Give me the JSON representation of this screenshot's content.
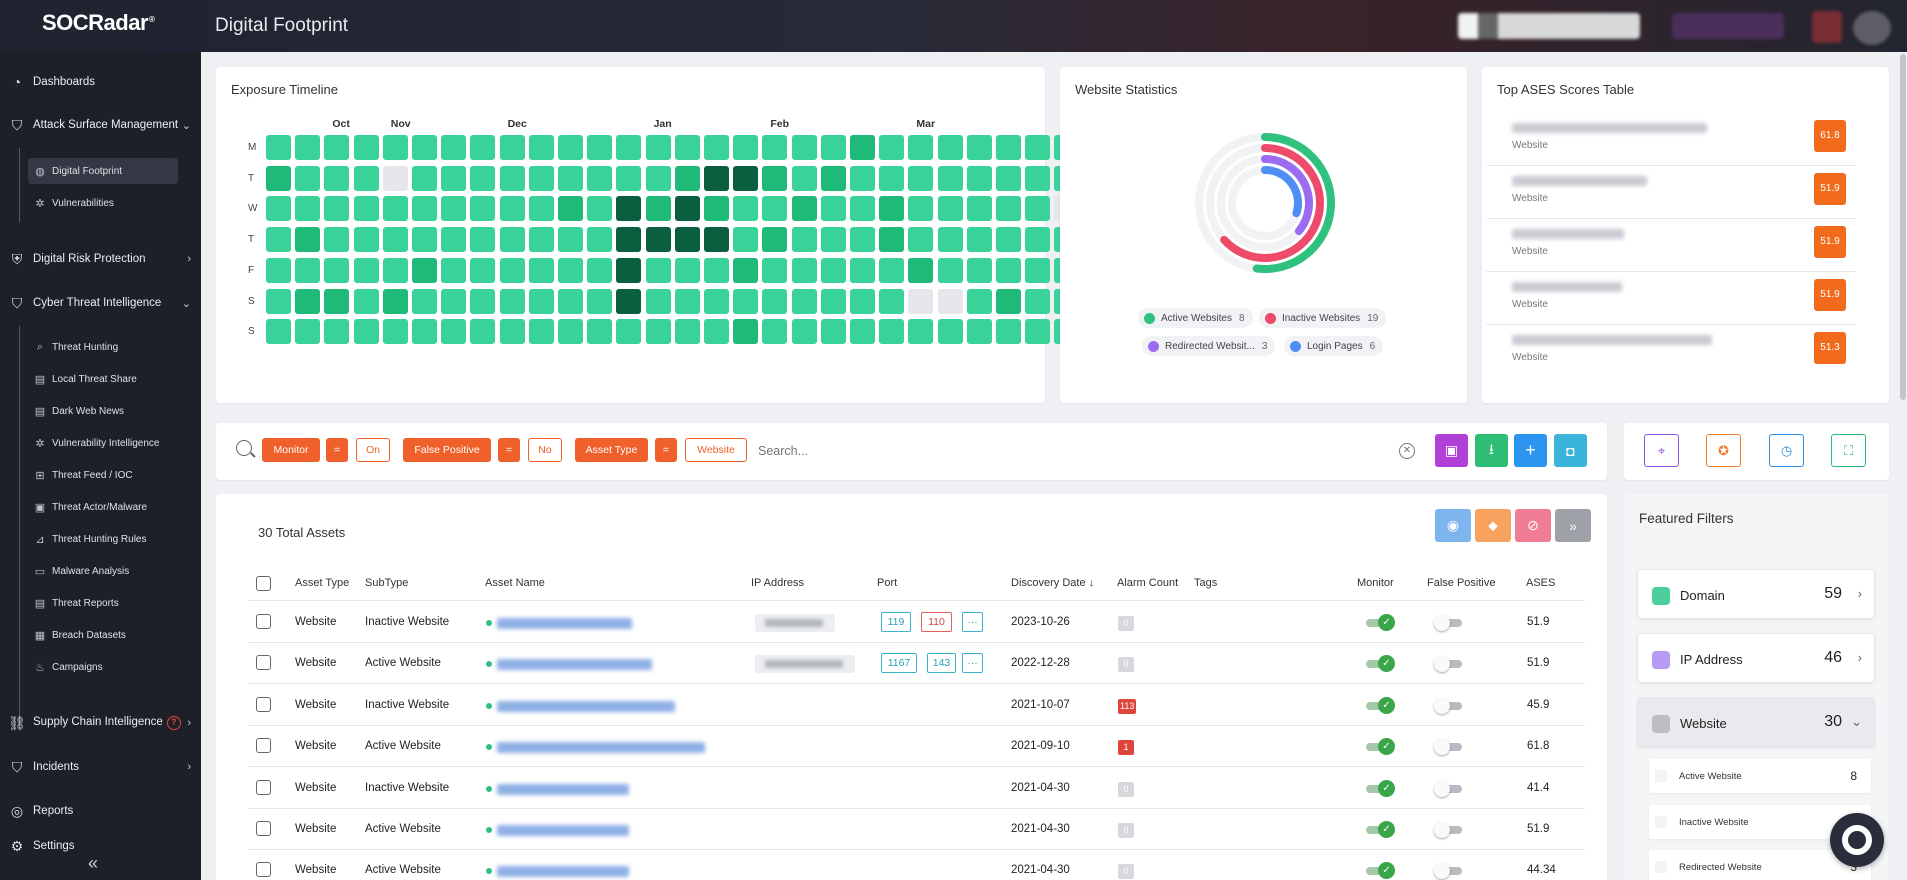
{
  "app": {
    "logo": "SOCRadar",
    "logo_mark": "®",
    "page_title": "Digital Footprint"
  },
  "sidebar": {
    "dashboards": "Dashboards",
    "attack_surface": "Attack Surface Management",
    "digital_footprint": "Digital Footprint",
    "vulnerabilities": "Vulnerabilities",
    "digital_risk": "Digital Risk Protection",
    "cti": "Cyber Threat Intelligence",
    "threat_hunting": "Threat Hunting",
    "local_threat_share": "Local Threat Share",
    "dark_web_news": "Dark Web News",
    "vulnerability_intelligence": "Vulnerability Intelligence",
    "threat_feed": "Threat Feed / IOC",
    "threat_actor": "Threat Actor/Malware",
    "threat_hunting_rules": "Threat Hunting Rules",
    "malware_analysis": "Malware Analysis",
    "threat_reports": "Threat Reports",
    "breach_datasets": "Breach Datasets",
    "campaigns": "Campaigns",
    "supply_chain": "Supply Chain Intelligence",
    "incidents": "Incidents",
    "reports": "Reports",
    "settings": "Settings"
  },
  "exposure": {
    "title": "Exposure Timeline",
    "months": [
      "Oct",
      "Nov",
      "Dec",
      "Jan",
      "Feb",
      "Mar"
    ],
    "days": [
      "M",
      "T",
      "W",
      "T",
      "F",
      "S",
      "S"
    ],
    "grid": [
      "1111111111111111111121111111x",
      "2111x1111111112332121111111111",
      "111111111121323211211211111x",
      "1211111111113333121112111111",
      "1111121111113111211111211111",
      "1221211111113111111111xx1211",
      "1111111111111111211111111111"
    ],
    "colors": {
      "0": "#e3e4e8",
      "1": "#39d399",
      "2": "#1fb978",
      "3": "#0b5e3e",
      "x": "#e6e7ea"
    }
  },
  "website_stats": {
    "title": "Website Statistics",
    "legend": [
      {
        "label": "Active Websites",
        "count": "8",
        "color": "#2ec27e"
      },
      {
        "label": "Inactive Websites",
        "count": "19",
        "color": "#ee4a6a"
      },
      {
        "label": "Redirected Websit...",
        "count": "3",
        "color": "#9b6cf2"
      },
      {
        "label": "Login Pages",
        "count": "6",
        "color": "#4f8ef5"
      }
    ],
    "values": {
      "active": 8,
      "inactive": 19,
      "redirected": 3,
      "login": 6,
      "total": 30
    }
  },
  "ases_table": {
    "title": "Top ASES Scores Table",
    "rows": [
      {
        "type": "Website",
        "score": "61.8"
      },
      {
        "type": "Website",
        "score": "51.9"
      },
      {
        "type": "Website",
        "score": "51.9"
      },
      {
        "type": "Website",
        "score": "51.9"
      },
      {
        "type": "Website",
        "score": "51.3"
      }
    ]
  },
  "filters": {
    "chips": [
      {
        "key": "Monitor",
        "op": "=",
        "val": "On"
      },
      {
        "key": "False Positive",
        "op": "=",
        "val": "No"
      },
      {
        "key": "Asset Type",
        "op": "=",
        "val": "Website"
      }
    ],
    "search_placeholder": "Search..."
  },
  "assets": {
    "total_label": "30 Total Assets",
    "columns": [
      "Asset Type",
      "SubType",
      "Asset Name",
      "IP Address",
      "Port",
      "Discovery Date",
      "Alarm Count",
      "Tags",
      "Monitor",
      "False Positive",
      "ASES"
    ],
    "sort_indicator": "↓",
    "rows": [
      {
        "type": "Website",
        "subtype": "Inactive Website",
        "ports": [
          "119",
          "110",
          "···"
        ],
        "date": "2023-10-26",
        "alarm": "0",
        "ases": "51.9"
      },
      {
        "type": "Website",
        "subtype": "Active Website",
        "ports": [
          "1167",
          "143",
          "···"
        ],
        "date": "2022-12-28",
        "alarm": "0",
        "ases": "51.9"
      },
      {
        "type": "Website",
        "subtype": "Inactive Website",
        "ports": [],
        "date": "2021-10-07",
        "alarm": "113",
        "ases": "45.9"
      },
      {
        "type": "Website",
        "subtype": "Active Website",
        "ports": [],
        "date": "2021-09-10",
        "alarm": "1",
        "ases": "61.8"
      },
      {
        "type": "Website",
        "subtype": "Inactive Website",
        "ports": [],
        "date": "2021-04-30",
        "alarm": "0",
        "ases": "41.4"
      },
      {
        "type": "Website",
        "subtype": "Active Website",
        "ports": [],
        "date": "2021-04-30",
        "alarm": "0",
        "ases": "51.9"
      },
      {
        "type": "Website",
        "subtype": "Active Website",
        "ports": [],
        "date": "2021-04-30",
        "alarm": "0",
        "ases": "44.34"
      }
    ]
  },
  "featured": {
    "title": "Featured Filters",
    "items": [
      {
        "label": "Domain",
        "count": "59",
        "color": "#4ccf9a",
        "chevron": "›"
      },
      {
        "label": "IP Address",
        "count": "46",
        "color": "#b79cf5",
        "chevron": "›"
      },
      {
        "label": "Website",
        "count": "30",
        "color": "#bcbec4",
        "chevron": "⌄"
      }
    ],
    "sub": [
      {
        "label": "Active Website",
        "count": "8"
      },
      {
        "label": "Inactive Website",
        "count": ""
      },
      {
        "label": "Redirected Website",
        "count": "3"
      }
    ]
  }
}
